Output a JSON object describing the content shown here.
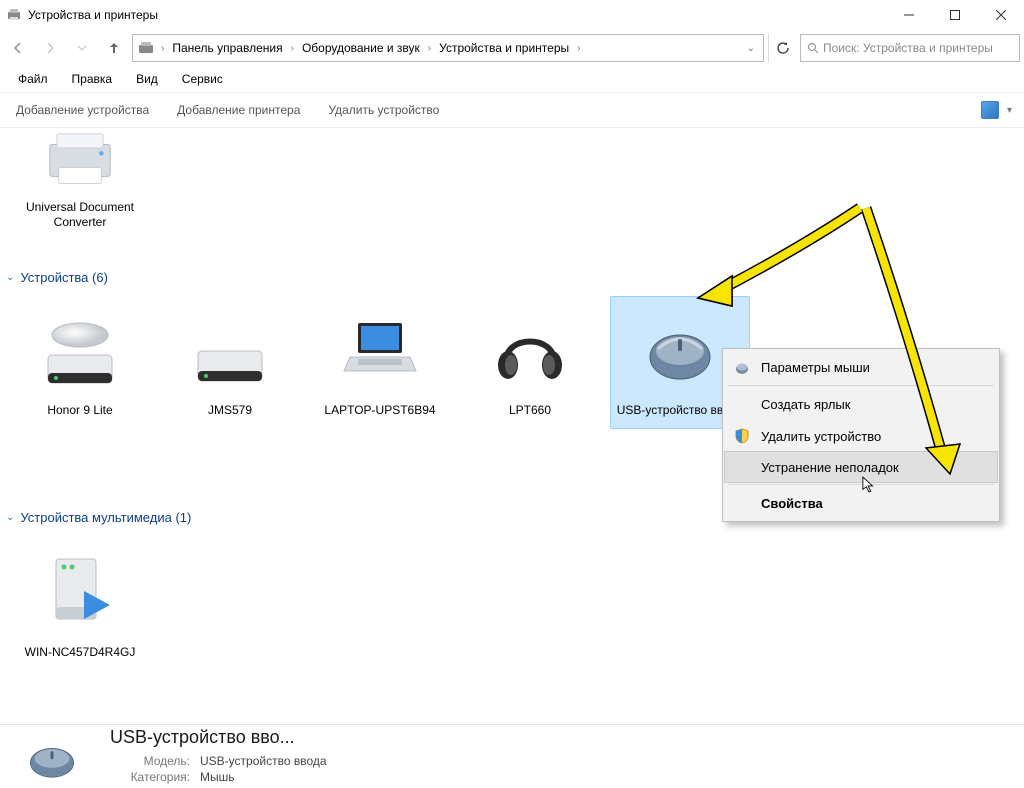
{
  "window": {
    "title": "Устройства и принтеры"
  },
  "breadcrumbs": {
    "b0": "Панель управления",
    "b1": "Оборудование и звук",
    "b2": "Устройства и принтеры"
  },
  "search": {
    "placeholder": "Поиск: Устройства и принтеры"
  },
  "menu": {
    "m0": "Файл",
    "m1": "Правка",
    "m2": "Вид",
    "m3": "Сервис"
  },
  "toolbar": {
    "t0": "Добавление устройства",
    "t1": "Добавление принтера",
    "t2": "Удалить устройство"
  },
  "printers": {
    "p0": "Universal Document Converter"
  },
  "groups": {
    "g0": "Устройства (6)",
    "g1": "Устройства мультимедиа (1)"
  },
  "devices": {
    "d0": "Honor 9 Lite",
    "d1": "JMS579",
    "d2": "LAPTOP-UPST6B94",
    "d3": "LPT660",
    "d4": "USB-устройство ввода"
  },
  "multimedia": {
    "m0": "WIN-NC457D4R4GJ"
  },
  "ctx": {
    "c0": "Параметры мыши",
    "c1": "Создать ярлык",
    "c2": "Удалить устройство",
    "c3": "Устранение неполадок",
    "c4": "Свойства"
  },
  "details": {
    "title": "USB-устройство вво...",
    "k0": "Модель:",
    "v0": "USB-устройство ввода",
    "k1": "Категория:",
    "v1": "Мышь"
  }
}
